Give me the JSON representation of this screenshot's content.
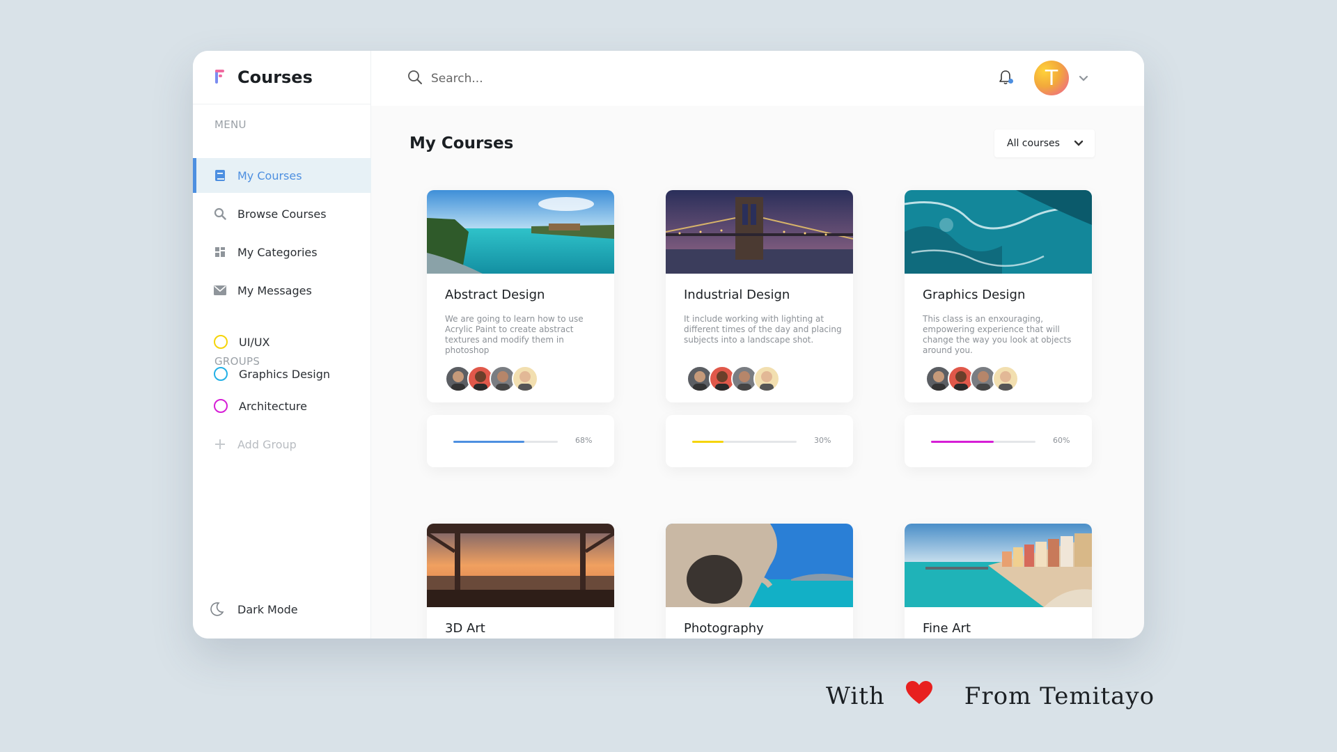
{
  "brand": {
    "title": "Courses"
  },
  "sidebar": {
    "menu_label": "MENU",
    "items": [
      {
        "label": "My Courses",
        "icon": "book-icon",
        "active": true
      },
      {
        "label": "Browse Courses",
        "icon": "search-icon"
      },
      {
        "label": "My Categories",
        "icon": "grid-icon"
      },
      {
        "label": "My Messages",
        "icon": "mail-icon"
      }
    ],
    "groups_label": "GROUPS",
    "groups": [
      {
        "label": "UI/UX",
        "color": "#f5d40a"
      },
      {
        "label": "Graphics Design",
        "color": "#23b0e6"
      },
      {
        "label": "Architecture",
        "color": "#d61ed6"
      }
    ],
    "add_group": "Add Group",
    "dark_mode": "Dark Mode"
  },
  "topbar": {
    "search_placeholder": "Search...",
    "avatar_initial": "T"
  },
  "main": {
    "title": "My Courses",
    "filter": "All courses"
  },
  "courses": [
    {
      "title": "Abstract Design",
      "description": "We are going to learn how to use Acrylic Paint to create abstract textures and modify them in photoshop",
      "progress": 68,
      "progress_label": "68%",
      "color": "#4d8fe0"
    },
    {
      "title": "Industrial Design",
      "description": "It include working with lighting at different times of the day and placing subjects into a landscape shot.",
      "progress": 30,
      "progress_label": "30%",
      "color": "#f5d40a"
    },
    {
      "title": "Graphics Design",
      "description": "This class is an enxouraging, empowering experience that will change the way you look at objects around you.",
      "progress": 60,
      "progress_label": "60%",
      "color": "#d61ed6"
    },
    {
      "title": "3D Art"
    },
    {
      "title": "Photography"
    },
    {
      "title": "Fine Art"
    }
  ],
  "signature": {
    "prefix": "With",
    "suffix": "From Temitayo",
    "heart_color": "#e8201f"
  }
}
